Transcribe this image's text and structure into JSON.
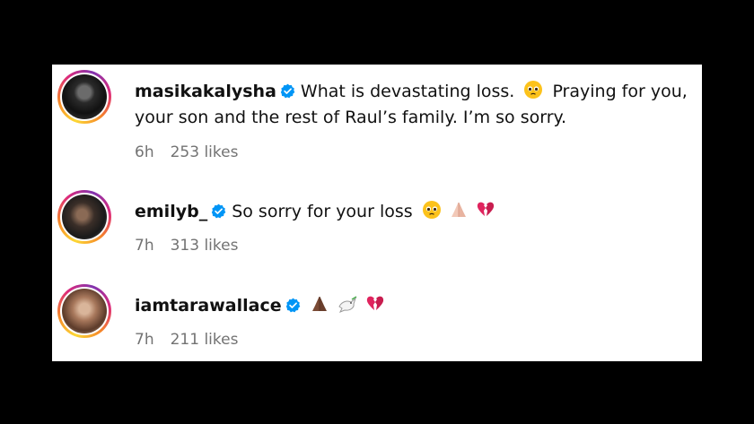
{
  "comments": [
    {
      "username": "masikakalysha",
      "text_before_emoji": "What is devastating loss.",
      "text_after_emoji": "Praying for you, your son and the rest of Raul’s family. I’m so sorry.",
      "time": "6h",
      "likes": "253 likes"
    },
    {
      "username": "emilyb_",
      "text": "So sorry for your loss",
      "time": "7h",
      "likes": "313 likes"
    },
    {
      "username": "iamtarawallace",
      "time": "7h",
      "likes": "211 likes"
    }
  ],
  "icons": {
    "verified": "verified-badge-icon",
    "tearful_face": "pleading-face-emoji",
    "praying_hands": "folded-hands-emoji",
    "dove": "dove-emoji",
    "broken_heart": "broken-heart-emoji"
  },
  "colors": {
    "background": "#000000",
    "panel": "#ffffff",
    "verified_blue": "#0095f6",
    "meta_gray": "#737373",
    "broken_heart": "#e0245e"
  }
}
